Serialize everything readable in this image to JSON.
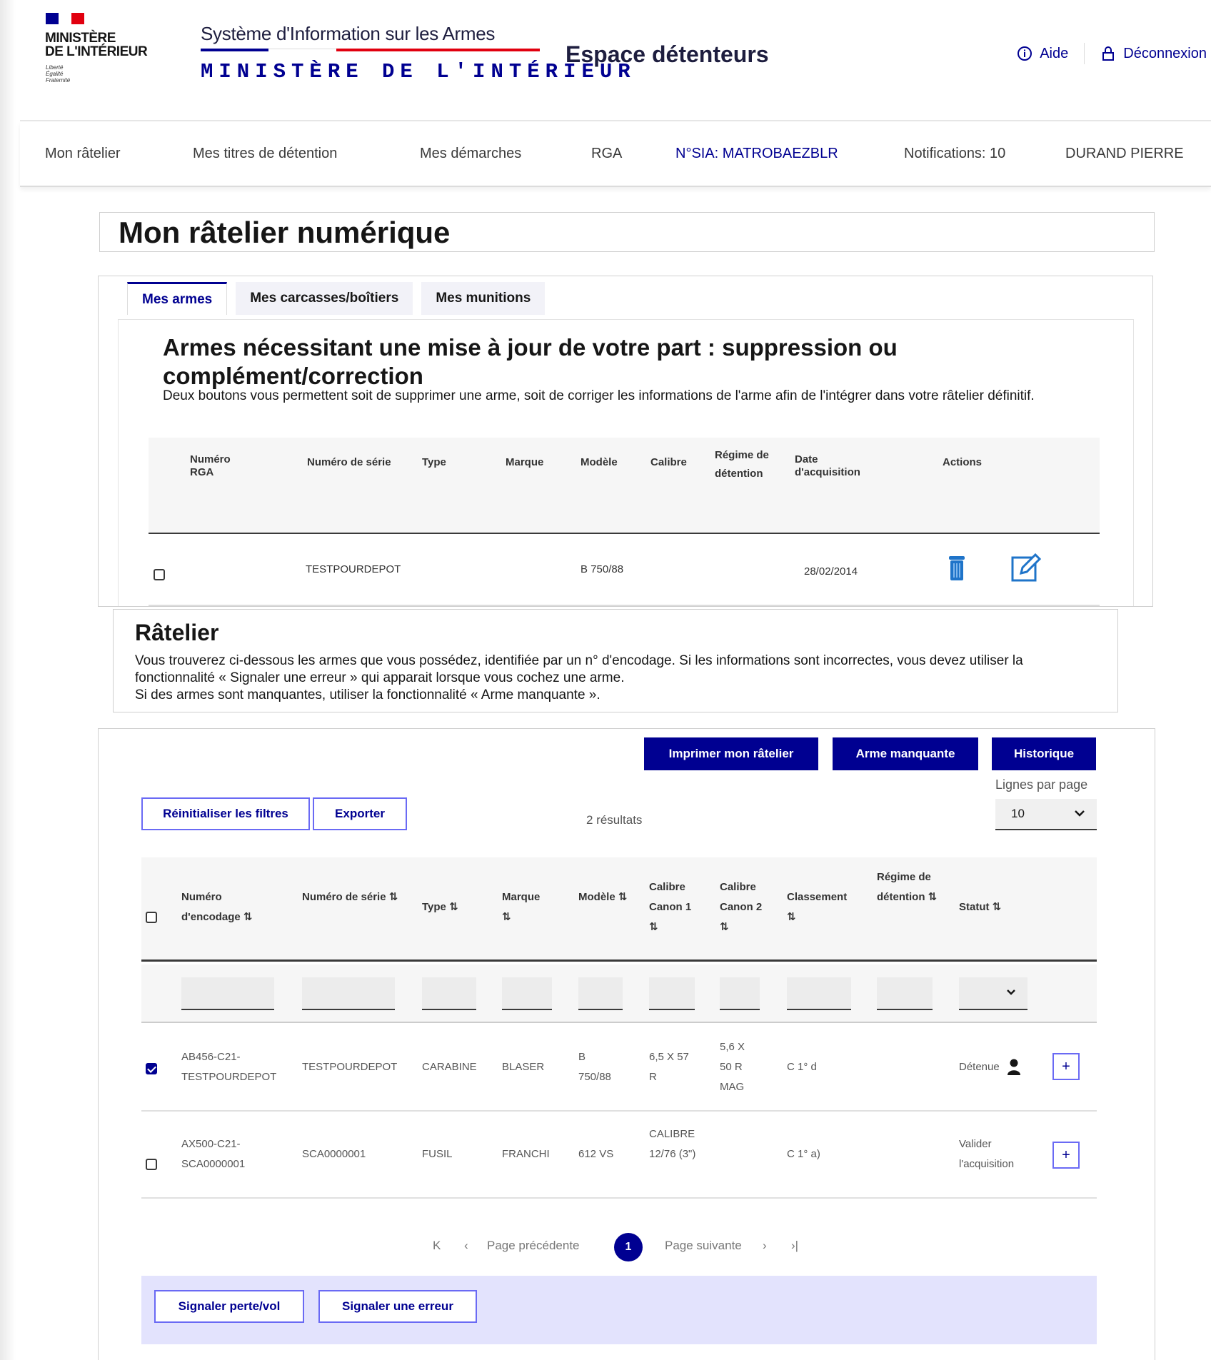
{
  "header": {
    "ministere": "MINISTÈRE\nDE L'INTÉRIEUR",
    "devise": "Liberté\nÉgalité\nFraternité",
    "sia_title": "Système d'Information sur les Armes",
    "sia_subtitle": "MINISTÈRE DE L'INTÉRIEUR",
    "espace": "Espace détenteurs",
    "links": {
      "aide": "Aide",
      "deconnexion": "Déconnexion"
    },
    "colors": {
      "blue": "#000091",
      "red": "#e1000f"
    }
  },
  "nav": {
    "items": [
      "Mon râtelier",
      "Mes titres de détention",
      "Mes démarches",
      "RGA",
      "N°SIA: MATROBAEZBLR",
      "Notifications: 10",
      "DURAND PIERRE"
    ]
  },
  "page_title": "Mon râtelier numérique",
  "tabs": [
    "Mes armes",
    "Mes carcasses/boîtiers",
    "Mes munitions"
  ],
  "update_section": {
    "title": "Armes nécessitant une mise à jour de votre part : suppression ou complément/correction",
    "description": "Deux boutons vous permettent soit de supprimer une arme, soit de corriger les informations de  l'arme afin de l'intégrer dans votre râtelier définitif.",
    "columns": {
      "rga": "Numéro RGA",
      "serie": "Numéro de série",
      "type": "Type",
      "marque": "Marque",
      "modele": "Modèle",
      "calibre": "Calibre",
      "regime": "Régime de détention",
      "date": "Date d'acquisition",
      "actions": "Actions"
    },
    "row": {
      "serie": "TESTPOURDEPOT",
      "modele": "B 750/88",
      "date": "28/02/2014"
    }
  },
  "ratelier": {
    "title": "Râtelier",
    "description": "Vous trouverez ci-dessous les armes que vous possédez, identifiée par un n° d'encodage. Si les informations sont incorrectes, vous devez utiliser la fonctionnalité « Signaler une erreur » qui apparait lorsque vous cochez une arme.\nSi des armes sont manquantes, utiliser la fonctionnalité « Arme manquante »."
  },
  "toolbar": {
    "imprimer": "Imprimer mon râtelier",
    "arme_manquante": "Arme manquante",
    "historique": "Historique",
    "reinitialiser": "Réinitialiser les filtres",
    "exporter": "Exporter",
    "lines_label": "Lignes par page",
    "lines_value": "10",
    "results": "2 résultats"
  },
  "table": {
    "columns": {
      "encodage": "Numéro d'encodage ⇅",
      "serie": "Numéro de série ⇅",
      "type": "Type ⇅",
      "marque": "Marque ⇅",
      "modele": "Modèle ⇅",
      "calibre1": "Calibre Canon 1 ⇅",
      "calibre2": "Calibre Canon 2 ⇅",
      "classement": "Classement ⇅",
      "regime": "Régime de détention ⇅",
      "statut": "Statut ⇅"
    },
    "rows": [
      {
        "checked": true,
        "encodage": "AB456-C21-TESTPOURDEPOT",
        "serie": "TESTPOURDEPOT",
        "type": "CARABINE",
        "marque": "BLASER",
        "modele": "B 750/88",
        "calibre1": "6,5 X 57 R",
        "calibre2": "5,6 X 50 R MAG",
        "classement": "C 1° d",
        "regime": "",
        "statut": "Détenue"
      },
      {
        "checked": false,
        "encodage": "AX500-C21-SCA0000001",
        "serie": "SCA0000001",
        "type": "FUSIL",
        "marque": "FRANCHI",
        "modele": "612 VS",
        "calibre1": "CALIBRE 12/76 (3\")",
        "calibre2": "",
        "classement": "C 1° a)",
        "regime": "",
        "statut": "Valider l'acquisition"
      }
    ]
  },
  "pagination": {
    "first": "K",
    "prev_arrow": "‹",
    "prev": "Page précédente",
    "current": "1",
    "next": "Page suivante",
    "next_arrow": "›",
    "last": "›|"
  },
  "footer": {
    "perte": "Signaler perte/vol",
    "erreur": "Signaler une erreur"
  }
}
